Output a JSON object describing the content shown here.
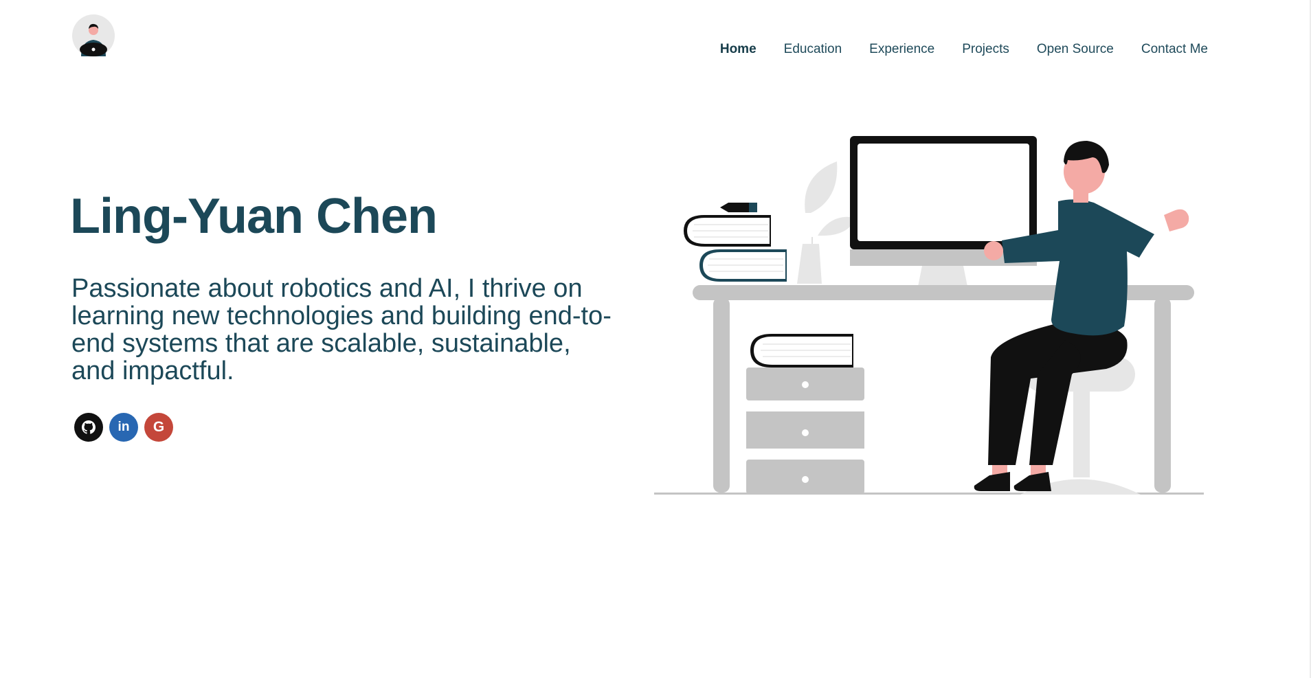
{
  "header": {
    "nav": [
      "Home",
      "Education",
      "Experience",
      "Projects",
      "Open Source",
      "Contact Me"
    ],
    "active_item": "Home"
  },
  "hero": {
    "name": "Ling-Yuan Chen",
    "tagline": "Passionate about robotics and AI, I thrive on learning new technologies and building end-to-end systems that are scalable, sustainable, and impactful."
  },
  "socials": [
    {
      "icon": "github-icon",
      "text": "",
      "color": "#111111"
    },
    {
      "icon": "linkedin-icon",
      "text": "in",
      "color": "#2867b2"
    },
    {
      "icon": "google-icon",
      "text": "G",
      "color": "#c4473a"
    }
  ],
  "colors": {
    "primary_text": "#1c4858",
    "shirt": "#1c4858",
    "furniture": "#c4c4c4",
    "skin": "#f4aaa5"
  }
}
